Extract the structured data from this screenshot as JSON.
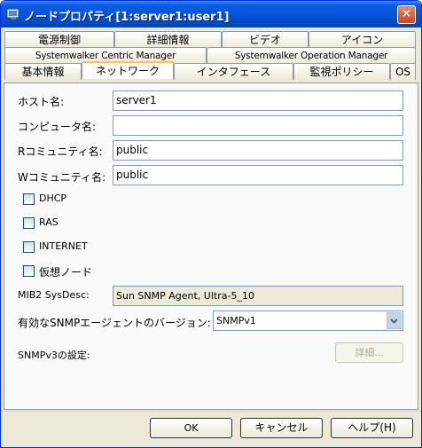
{
  "window": {
    "title": "ノードプロパティ[1:server1:user1]",
    "close_symbol": "✕"
  },
  "tabs": {
    "row1": [
      "電源制御",
      "詳細情報",
      "ビデオ",
      "アイコン"
    ],
    "row2": [
      "Systemwalker Centric Manager",
      "Systemwalker Operation Manager"
    ],
    "row3": [
      "基本情報",
      "ネットワーク",
      "インタフェース",
      "監視ポリシー",
      "OS"
    ],
    "active": "ネットワーク"
  },
  "form": {
    "host_label": "ホスト名:",
    "host_value": "server1",
    "computer_label": "コンピュータ名:",
    "computer_value": "",
    "rcommunity_label": "Rコミュニティ名:",
    "rcommunity_value": "public",
    "wcommunity_label": "Wコミュニティ名:",
    "wcommunity_value": "public",
    "checkboxes": [
      {
        "label": "DHCP",
        "checked": false
      },
      {
        "label": "RAS",
        "checked": false
      },
      {
        "label": "INTERNET",
        "checked": false
      },
      {
        "label": "仮想ノード",
        "checked": false
      }
    ],
    "sysdesc_label": "MIB2 SysDesc:",
    "sysdesc_value": "Sun SNMP Agent, Ultra-5_10",
    "snmp_version_label": "有効なSNMPエージェントのバージョン:",
    "snmp_version_value": "SNMPv1",
    "snmpv3_label": "SNMPv3の設定:",
    "detail_button": "詳細..."
  },
  "footer": {
    "ok": "OK",
    "cancel": "キャンセル",
    "help": "ヘルプ(H)"
  },
  "colors": {
    "titlebar": "#0654da",
    "dialog_bg": "#ece9d8",
    "active_tab_accent": "#ffc83c"
  }
}
